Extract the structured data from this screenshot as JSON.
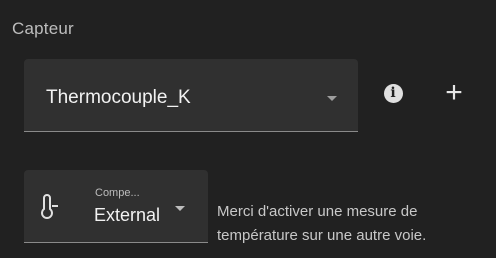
{
  "section": {
    "title": "Capteur"
  },
  "sensor_select": {
    "value": "Thermocouple_K",
    "icon": "caret-down-icon"
  },
  "actions": {
    "info_icon": "info-icon",
    "info_glyph": "i",
    "add_icon": "plus-icon",
    "add_glyph": "+"
  },
  "compensation": {
    "icon": "thermometer-icon",
    "label": "Compe...",
    "value": "External"
  },
  "hint": {
    "line1": "Merci d'activer une mesure de",
    "line2": "température sur une autre voie."
  },
  "colors": {
    "background": "#212121",
    "field_background": "#303030",
    "text": "#f2f2f2",
    "muted_text": "#bdbdbd"
  }
}
